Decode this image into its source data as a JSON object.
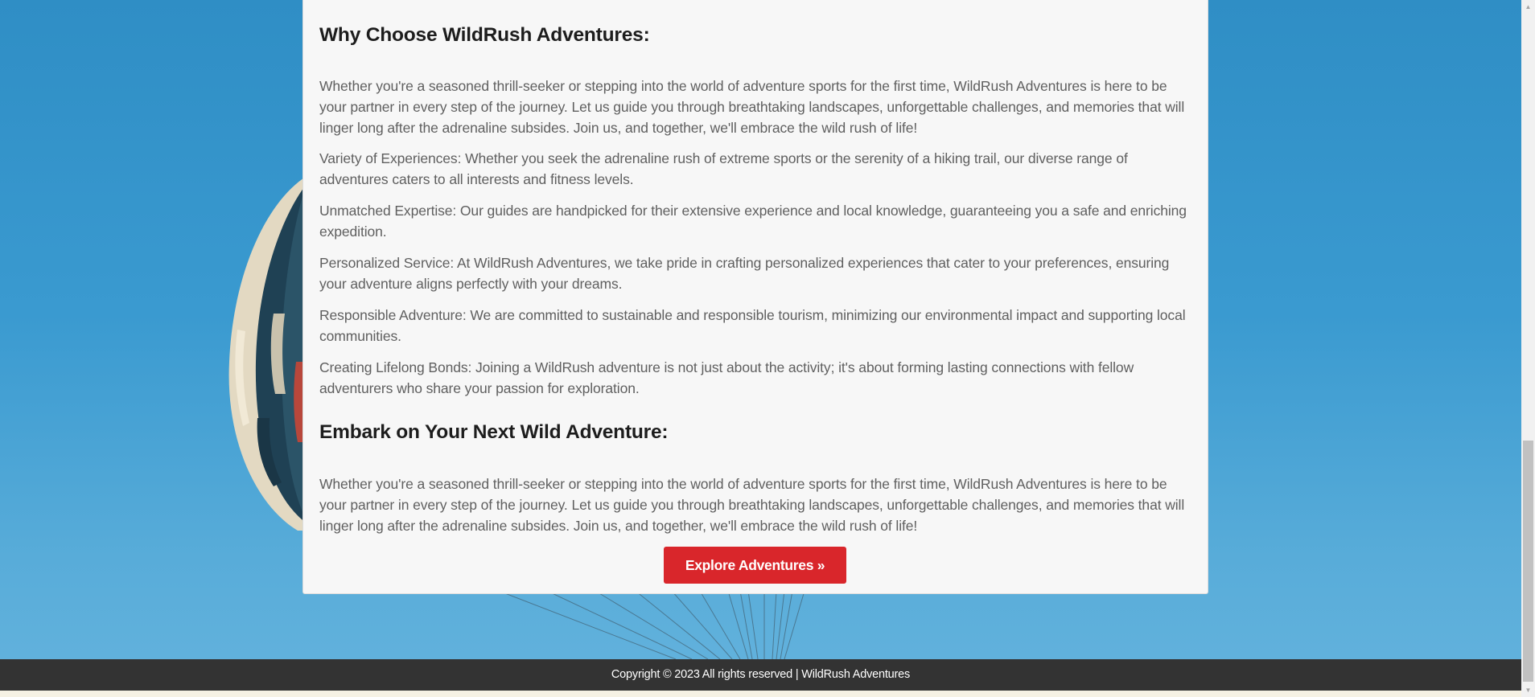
{
  "why_section": {
    "heading": "Why Choose WildRush Adventures:",
    "intro": "Whether you're a seasoned thrill-seeker or stepping into the world of adventure sports for the first time, WildRush Adventures is here to be your partner in every step of the journey. Let us guide you through breathtaking landscapes, unforgettable challenges, and memories that will linger long after the adrenaline subsides. Join us, and together, we'll embrace the wild rush of life!",
    "points": [
      "Variety of Experiences: Whether you seek the adrenaline rush of extreme sports or the serenity of a hiking trail, our diverse range of adventures caters to all interests and fitness levels.",
      "Unmatched Expertise: Our guides are handpicked for their extensive experience and local knowledge, guaranteeing you a safe and enriching expedition.",
      "Personalized Service: At WildRush Adventures, we take pride in crafting personalized experiences that cater to your preferences, ensuring your adventure aligns perfectly with your dreams.",
      "Responsible Adventure: We are committed to sustainable and responsible tourism, minimizing our environmental impact and supporting local communities.",
      "Creating Lifelong Bonds: Joining a WildRush adventure is not just about the activity; it's about forming lasting connections with fellow adventurers who share your passion for exploration."
    ]
  },
  "embark_section": {
    "heading": "Embark on Your Next Wild Adventure:",
    "text": "Whether you're a seasoned thrill-seeker or stepping into the world of adventure sports for the first time, WildRush Adventures is here to be your partner in every step of the journey. Let us guide you through breathtaking landscapes, unforgettable challenges, and memories that will linger long after the adrenaline subsides. Join us, and together, we'll embrace the wild rush of life!",
    "cta_label": "Explore Adventures »"
  },
  "footer": {
    "copyright": "Copyright © 2023 All rights reserved | WildRush Adventures"
  },
  "colors": {
    "sky": "#3a9ad0",
    "card_background": "#f7f7f7",
    "cta_background": "#d9262b",
    "footer_background": "#333333"
  },
  "scrollbar": {
    "up_icon": "triangle-up-icon",
    "down_icon": "triangle-down-icon"
  }
}
